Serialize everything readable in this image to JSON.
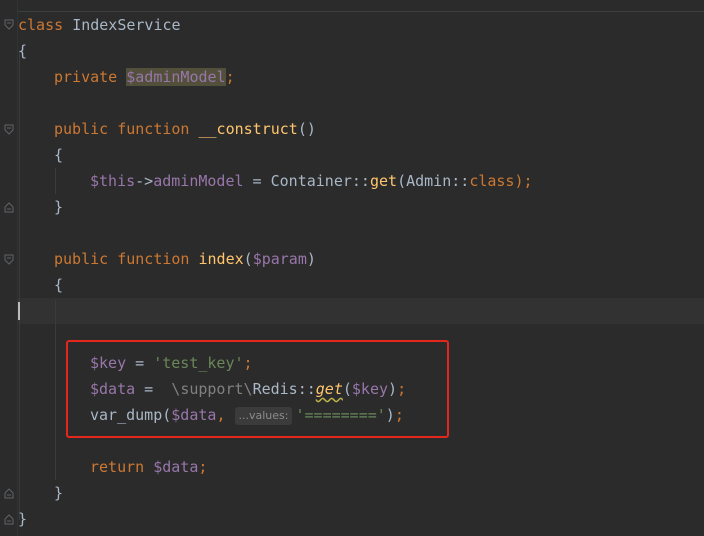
{
  "code": {
    "class_kw": "class",
    "class_name": "IndexService",
    "open_brace": "{",
    "close_brace": "}",
    "private_kw": "private",
    "admin_model_var": "$adminModel",
    "semicolon": ";",
    "public_kw": "public",
    "function_kw": "function",
    "construct_name": "__construct",
    "empty_parens": "()",
    "this_var": "$this",
    "arrow": "->",
    "admin_model_prop": "adminModel",
    "assign": " = ",
    "container": "Container",
    "dcolon": "::",
    "get_fn": "get",
    "open_paren": "(",
    "admin": "Admin",
    "class_const": "class",
    "close_paren_semi": ");",
    "index_fn": "index",
    "param_var": "$param",
    "close_paren": ")",
    "key_var": "$key",
    "test_key_str": "'test_key'",
    "data_var": "$data",
    "assign_ws": " =  ",
    "backslash": "\\",
    "support_ns": "support",
    "redis": "Redis",
    "var_dump_fn": "var_dump",
    "comma": ", ",
    "values_hint": "...values:",
    "equals_str": "'========'",
    "return_kw": "return"
  },
  "colors": {
    "background": "#2b2b2b",
    "keyword": "#cc7832",
    "variable": "#9876aa",
    "function": "#ffc66d",
    "string": "#6a8759",
    "text": "#a9b7c6",
    "highlight_box": "#e3271c"
  },
  "icons": {
    "fold_open": "fold-open-icon",
    "fold_close": "fold-close-icon"
  }
}
